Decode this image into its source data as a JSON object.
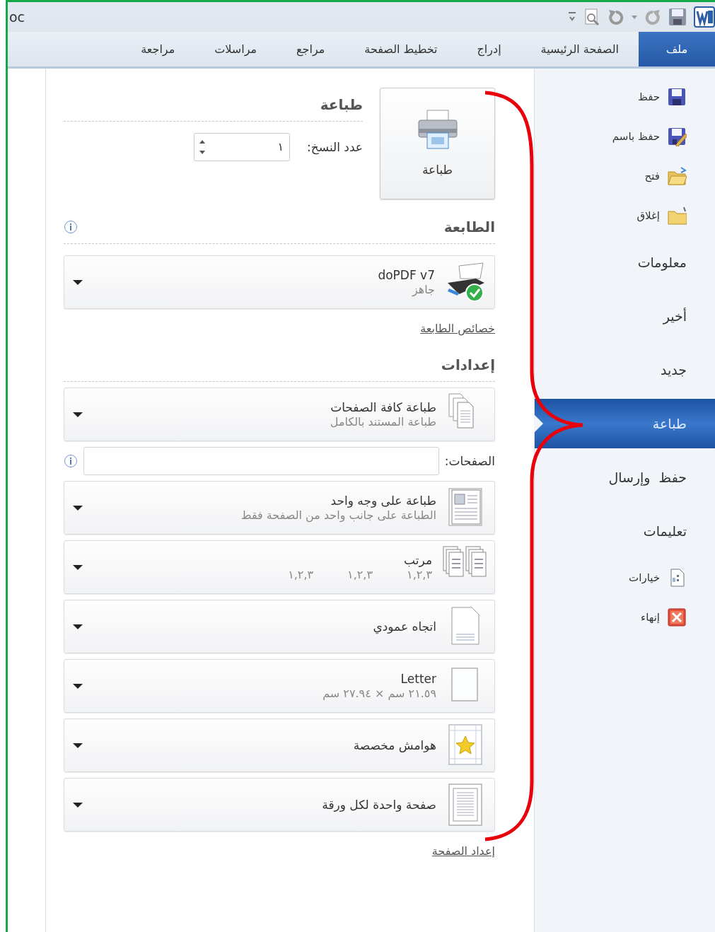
{
  "window": {
    "title": "oc"
  },
  "tabs": [
    {
      "label": "ملف",
      "selected": true
    },
    {
      "label": "الصفحة الرئيسية",
      "selected": false
    },
    {
      "label": "إدراج",
      "selected": false
    },
    {
      "label": "تخطيط الصفحة",
      "selected": false
    },
    {
      "label": "مراجع",
      "selected": false
    },
    {
      "label": "مراسلات",
      "selected": false
    },
    {
      "label": "مراجعة",
      "selected": false
    }
  ],
  "sidebar": {
    "items": [
      {
        "label": "حفظ",
        "kind": "icon",
        "selected": false
      },
      {
        "label": "حفظ باسم",
        "kind": "icon",
        "selected": false
      },
      {
        "label": "فتح",
        "kind": "icon",
        "selected": false
      },
      {
        "label": "إغلاق",
        "kind": "icon",
        "selected": false
      },
      {
        "label": "معلومات",
        "kind": "text",
        "selected": false
      },
      {
        "label": "أخير",
        "kind": "text",
        "selected": false
      },
      {
        "label": "جديد",
        "kind": "text",
        "selected": false
      },
      {
        "label": "طباعة",
        "kind": "text",
        "selected": true
      },
      {
        "label": "حفظ  وإرسال",
        "kind": "text",
        "selected": false
      },
      {
        "label": "تعليمات",
        "kind": "text",
        "selected": false
      },
      {
        "label": "خيارات",
        "kind": "icon",
        "selected": false
      },
      {
        "label": "إنهاء",
        "kind": "icon",
        "selected": false
      }
    ]
  },
  "print": {
    "heading": "طباعة",
    "button": "طباعة",
    "copies_label": "عدد النسخ:",
    "copies_value": "١"
  },
  "printer": {
    "heading": "الطابعة",
    "name": "doPDF v7",
    "status": "جاهز",
    "properties_link": "خصائص الطابعة"
  },
  "settings": {
    "heading": "إعدادات",
    "options": [
      {
        "kind": "dropdown",
        "title": "طباعة كافة الصفحات",
        "subtitle": "طباعة المستند بالكامل"
      },
      {
        "kind": "field",
        "label": "الصفحات:"
      },
      {
        "kind": "dropdown",
        "title": "طباعة على وجه واحد",
        "subtitle": "الطباعة على جانب واحد من الصفحة فقط"
      },
      {
        "kind": "collated",
        "title": "مرتب",
        "sequences": [
          "١,٢,٣",
          "١,٢,٣",
          "١,٢,٣"
        ]
      },
      {
        "kind": "dropdown",
        "title": "اتجاه عمودي"
      },
      {
        "kind": "dropdown",
        "title": "Letter",
        "subtitle": "٢١.٥٩ سم × ٢٧.٩٤ سم"
      },
      {
        "kind": "dropdown",
        "title": "هوامش مخصصة"
      },
      {
        "kind": "dropdown",
        "title": "صفحة واحدة لكل ورقة"
      }
    ],
    "page_setup_link": "إعداد الصفحة"
  }
}
